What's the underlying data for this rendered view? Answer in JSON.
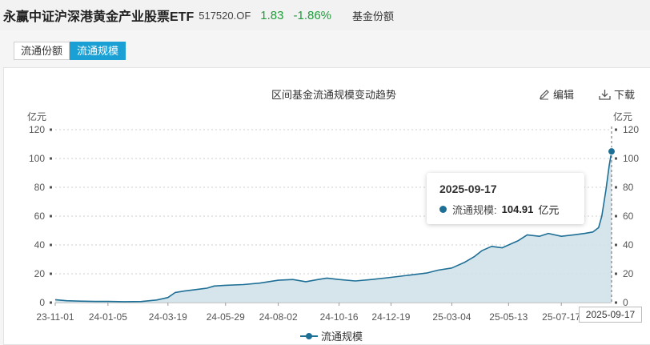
{
  "header": {
    "fund_name": "永赢中证沪深港黄金产业股票ETF",
    "fund_code": "517520.OF",
    "price": "1.83",
    "change": "-1.86%",
    "metric_label": "基金份额"
  },
  "tabs": [
    {
      "label": "流通份额",
      "active": false
    },
    {
      "label": "流通规模",
      "active": true
    }
  ],
  "toolbar": {
    "edit_label": "编辑",
    "download_label": "下载"
  },
  "colors": {
    "series": "#1e6f96",
    "fill": "#cfe0e8",
    "tab_active": "#1aa0d4",
    "up_down": "#1f9d3a"
  },
  "tooltip": {
    "date": "2025-09-17",
    "series_name": "流通规模:",
    "value": "104.91",
    "unit": "亿元"
  },
  "hover_date": "2025-09-17",
  "chart_data": {
    "type": "area",
    "title": "区间基金流通规模变动趋势",
    "ylabel": "亿元",
    "ylabel_right": "亿元",
    "ylim": [
      0,
      120
    ],
    "yticks": [
      "0",
      "20",
      "40",
      "60",
      "80",
      "100",
      "120"
    ],
    "xticks": [
      "23-11-01",
      "24-01-05",
      "24-03-19",
      "24-05-29",
      "24-08-02",
      "24-10-16",
      "24-12-19",
      "25-03-04",
      "25-05-13",
      "25-07-17"
    ],
    "grid": true,
    "legend": "bottom",
    "series": [
      {
        "name": "流通规模",
        "x": [
          "2023-11-01",
          "2023-11-15",
          "2023-12-01",
          "2023-12-20",
          "2024-01-05",
          "2024-01-25",
          "2024-02-15",
          "2024-03-05",
          "2024-03-19",
          "2024-03-28",
          "2024-04-08",
          "2024-04-22",
          "2024-05-06",
          "2024-05-15",
          "2024-05-29",
          "2024-06-20",
          "2024-07-10",
          "2024-08-02",
          "2024-08-20",
          "2024-09-05",
          "2024-09-20",
          "2024-10-01",
          "2024-10-16",
          "2024-11-05",
          "2024-11-25",
          "2024-12-19",
          "2025-01-10",
          "2025-02-01",
          "2025-02-15",
          "2025-03-04",
          "2025-03-20",
          "2025-04-01",
          "2025-04-10",
          "2025-04-22",
          "2025-05-05",
          "2025-05-13",
          "2025-05-25",
          "2025-06-05",
          "2025-06-20",
          "2025-07-01",
          "2025-07-17",
          "2025-08-01",
          "2025-08-15",
          "2025-08-25",
          "2025-09-01",
          "2025-09-05",
          "2025-09-10",
          "2025-09-14",
          "2025-09-17"
        ],
        "values": [
          2.0,
          1.3,
          1.0,
          0.8,
          0.8,
          0.6,
          0.7,
          1.8,
          3.5,
          7.0,
          8.0,
          9.0,
          10.0,
          11.5,
          12.0,
          12.5,
          13.5,
          15.5,
          16.0,
          14.5,
          16.0,
          17.0,
          16.0,
          15.0,
          16.0,
          17.5,
          19.0,
          20.5,
          22.5,
          24.0,
          28.0,
          32.0,
          36.0,
          39.0,
          38.0,
          40.0,
          43.0,
          47.0,
          46.0,
          48.0,
          46.0,
          47.0,
          48.0,
          49.0,
          52.0,
          60.0,
          78.0,
          95.0,
          104.91
        ]
      }
    ]
  }
}
